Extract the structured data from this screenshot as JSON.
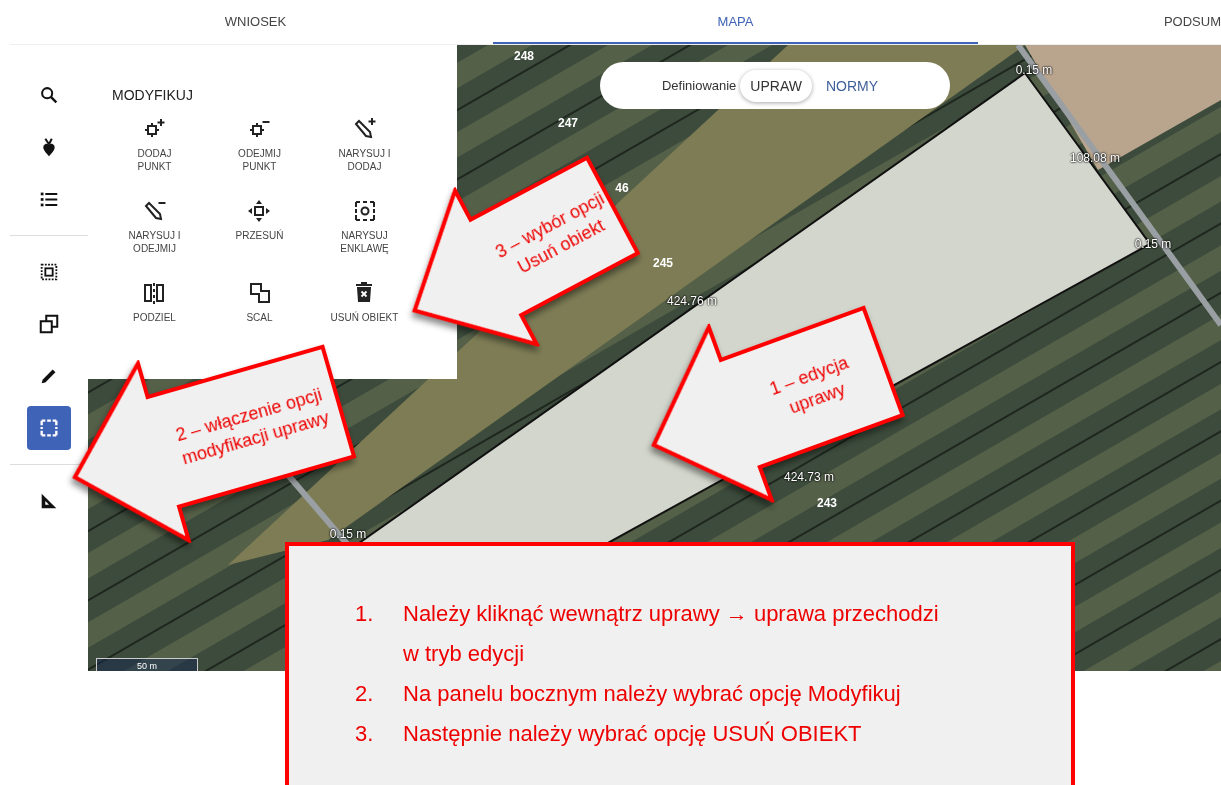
{
  "tabs": [
    {
      "label": "WNIOSEK",
      "selected": false
    },
    {
      "label": "MAPA",
      "selected": true
    },
    {
      "label": "PODSUM",
      "selected": false
    }
  ],
  "sidebar": {
    "items": [
      {
        "selected": false
      },
      {
        "selected": false
      },
      {
        "selected": false
      },
      {
        "selected": false
      },
      {
        "selected": false
      },
      {
        "selected": false
      },
      {
        "selected": true
      },
      {
        "selected": false
      }
    ]
  },
  "panel": {
    "title": "MODYFIKUJ",
    "tools": [
      {
        "label": "DODAJ\nPUNKT"
      },
      {
        "label": "ODEJMIJ\nPUNKT"
      },
      {
        "label": "NARYSUJ I\nDODAJ"
      },
      {
        "label": "NARYSUJ I\nODEJMIJ"
      },
      {
        "label": "PRZESUŃ"
      },
      {
        "label": "NARYSUJ\nENKLAWĘ"
      },
      {
        "label": "PODZIEL"
      },
      {
        "label": "SCAL"
      },
      {
        "label": "USUŃ OBIEKT"
      }
    ]
  },
  "map": {
    "mode_switch": {
      "label": "Definiowanie",
      "options": [
        {
          "label": "UPRAW",
          "selected": true
        },
        {
          "label": "NORMY",
          "selected": false
        }
      ]
    },
    "parcel_numbers": [
      "248",
      "247",
      "46",
      "245",
      "243"
    ],
    "measurements": [
      "0.15 m",
      "108.08 m",
      "0.15 m",
      "424.76 m",
      "424.73 m",
      "0.15 m"
    ],
    "scale": "50 m"
  },
  "callouts": [
    {
      "text": "3 – wybór opcji\nUsuń obiekt"
    },
    {
      "text": "2 – włączenie opcji\nmodyfikacji uprawy"
    },
    {
      "text": "1 – edycja\nuprawy"
    }
  ],
  "instructions": [
    {
      "number": "1.",
      "text": "Należy kliknąć wewnątrz uprawy → uprawa przechodzi w tryb edycji"
    },
    {
      "number": "2.",
      "text": "Na panelu bocznym należy wybrać opcję Modyfikuj"
    },
    {
      "number": "3.",
      "text": "Następnie należy wybrać opcję USUŃ OBIEKT"
    }
  ]
}
